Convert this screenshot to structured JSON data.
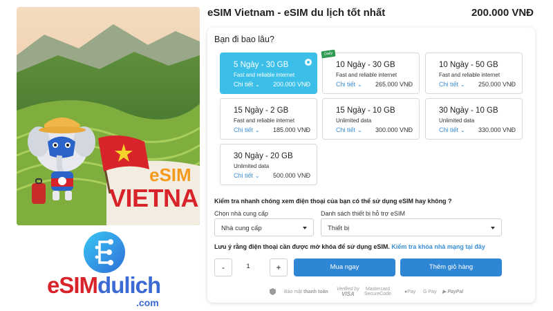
{
  "promo": {
    "esim_text": "eSIM",
    "country_text": "VIETNAM"
  },
  "brand": {
    "name_part1": "eSIM",
    "name_part2": "dulich",
    "domain": ".com"
  },
  "product": {
    "title": "eSIM Vietnam - eSIM du lịch tốt nhất",
    "price": "200.000 VNĐ"
  },
  "plan_selector": {
    "question": "Bạn đi bao lâu?",
    "detail_label": "Chi tiết",
    "plans": [
      {
        "title": "5 Ngày - 30 GB",
        "desc": "Fast and reliable internet",
        "price": "200.000 VNĐ",
        "selected": true,
        "badge": ""
      },
      {
        "title": "10 Ngày - 30 GB",
        "desc": "Fast and reliable internet",
        "price": "265.000 VNĐ",
        "selected": false,
        "badge": "Daily"
      },
      {
        "title": "10 Ngày - 50 GB",
        "desc": "Fast and reliable internet",
        "price": "250.000 VNĐ",
        "selected": false,
        "badge": ""
      },
      {
        "title": "15 Ngày - 2 GB",
        "desc": "Fast and reliable internet",
        "price": "185.000 VNĐ",
        "selected": false,
        "badge": ""
      },
      {
        "title": "15 Ngày - 10 GB",
        "desc": "Unlimited data",
        "price": "300.000 VNĐ",
        "selected": false,
        "badge": ""
      },
      {
        "title": "30 Ngày - 10 GB",
        "desc": "Unlimited data",
        "price": "330.000 VNĐ",
        "selected": false,
        "badge": ""
      },
      {
        "title": "30 Ngày - 20 GB",
        "desc": "Unlimited data",
        "price": "500.000 VNĐ",
        "selected": false,
        "badge": ""
      }
    ]
  },
  "compat": {
    "heading": "Kiểm tra nhanh chóng xem điện thoại của bạn có thể sử dụng eSIM hay không ?",
    "provider_label": "Chọn nhà cung cấp",
    "provider_value": "Nhà cung cấp",
    "device_label": "Danh sách thiết bị hỗ trợ eSIM",
    "device_value": "Thiết bị"
  },
  "note": {
    "text": "Lưu ý rằng điện thoại cần được mở khóa để sử dụng eSIM.",
    "link": "Kiểm tra khóa nhà mạng tại đây"
  },
  "purchase": {
    "minus": "-",
    "quantity": "1",
    "plus": "+",
    "buy_now": "Mua ngay",
    "add_to_cart": "Thêm giỏ hàng"
  },
  "payment": {
    "secure_prefix": "Bảo mật",
    "secure_bold": "thanh toán",
    "visa_line1": "Verified by",
    "visa_line2": "VISA",
    "mc_line1": "Mastercard",
    "mc_line2": "SecureCode",
    "apple_pay": "Pay",
    "google_pay": "G Pay",
    "paypal": "PayPal"
  },
  "colors": {
    "selected_plan": "#3bbfe9",
    "primary_button": "#2f86d4",
    "link": "#3a8fd6",
    "badge": "#2c9a52",
    "brand_red": "#d8232a",
    "brand_blue": "#3b6ad4"
  }
}
